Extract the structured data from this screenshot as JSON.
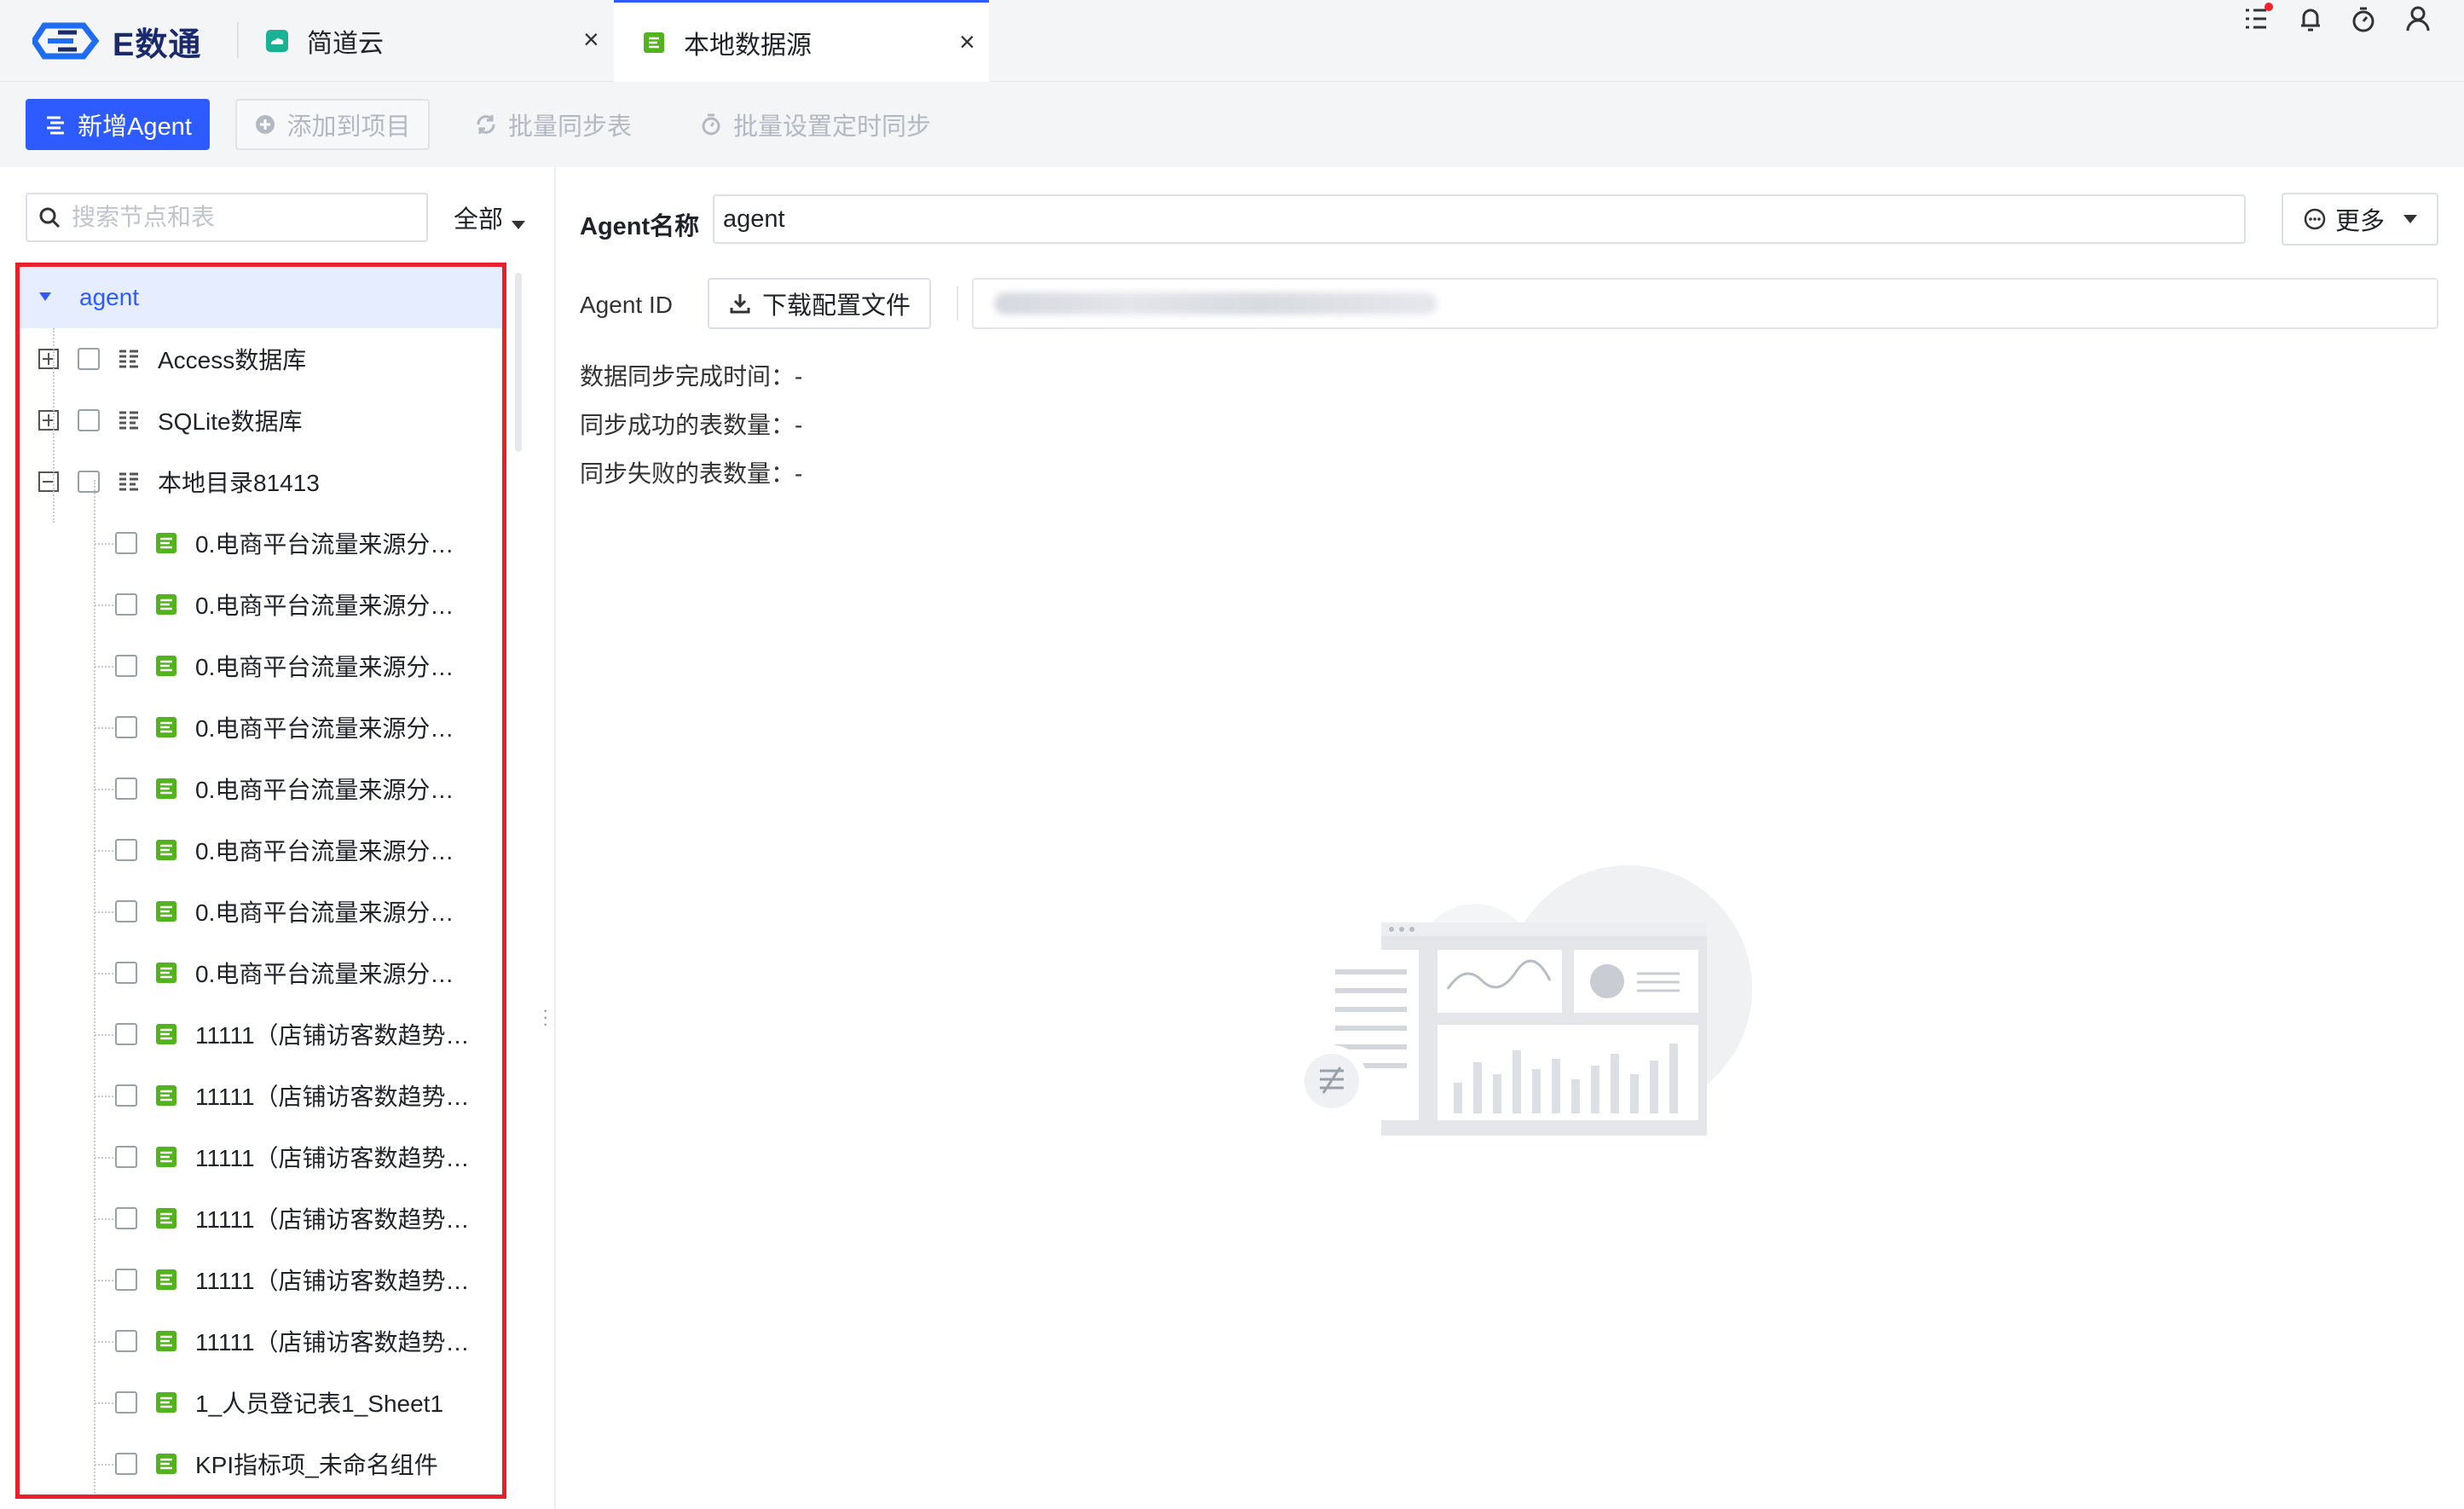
{
  "app": {
    "logo_text": "E数通"
  },
  "tabs": [
    {
      "label": "简道云",
      "close": "×"
    },
    {
      "label": "本地数据源",
      "close": "×"
    }
  ],
  "toolbar": {
    "add_agent": "新增Agent",
    "add_to_project": "添加到项目",
    "batch_sync": "批量同步表",
    "batch_schedule": "批量设置定时同步"
  },
  "left": {
    "search_placeholder": "搜索节点和表",
    "filter_label": "全部",
    "tree": [
      {
        "label": "agent",
        "level": 0,
        "type": "agent",
        "selected": true
      },
      {
        "label": "Access数据库",
        "level": 1,
        "type": "db",
        "expanded": false
      },
      {
        "label": "SQLite数据库",
        "level": 1,
        "type": "db",
        "expanded": false
      },
      {
        "label": "本地目录81413",
        "level": 1,
        "type": "db",
        "expanded": true
      },
      {
        "label": "0.电商平台流量来源分…",
        "level": 2,
        "type": "table"
      },
      {
        "label": "0.电商平台流量来源分…",
        "level": 2,
        "type": "table"
      },
      {
        "label": "0.电商平台流量来源分…",
        "level": 2,
        "type": "table"
      },
      {
        "label": "0.电商平台流量来源分…",
        "level": 2,
        "type": "table"
      },
      {
        "label": "0.电商平台流量来源分…",
        "level": 2,
        "type": "table"
      },
      {
        "label": "0.电商平台流量来源分…",
        "level": 2,
        "type": "table"
      },
      {
        "label": "0.电商平台流量来源分…",
        "level": 2,
        "type": "table"
      },
      {
        "label": "0.电商平台流量来源分…",
        "level": 2,
        "type": "table"
      },
      {
        "label": "11111（店铺访客数趋势…",
        "level": 2,
        "type": "table"
      },
      {
        "label": "11111（店铺访客数趋势…",
        "level": 2,
        "type": "table"
      },
      {
        "label": "11111（店铺访客数趋势…",
        "level": 2,
        "type": "table"
      },
      {
        "label": "11111（店铺访客数趋势…",
        "level": 2,
        "type": "table"
      },
      {
        "label": "11111（店铺访客数趋势…",
        "level": 2,
        "type": "table"
      },
      {
        "label": "11111（店铺访客数趋势…",
        "level": 2,
        "type": "table"
      },
      {
        "label": "1_人员登记表1_Sheet1",
        "level": 2,
        "type": "table"
      },
      {
        "label": "KPI指标项_未命名组件",
        "level": 2,
        "type": "table"
      }
    ]
  },
  "detail": {
    "agent_name_label": "Agent名称",
    "agent_name_value": "agent",
    "more_label": "更多",
    "agent_id_label": "Agent ID",
    "download_label": "下载配置文件",
    "stats": [
      {
        "label": "数据同步完成时间：",
        "value": "-"
      },
      {
        "label": "同步成功的表数量：",
        "value": "-"
      },
      {
        "label": "同步失败的表数量：",
        "value": "-"
      }
    ]
  },
  "colors": {
    "accent": "#2d5bff",
    "highlight_border": "#e8202a",
    "table_icon": "#52b41c"
  }
}
